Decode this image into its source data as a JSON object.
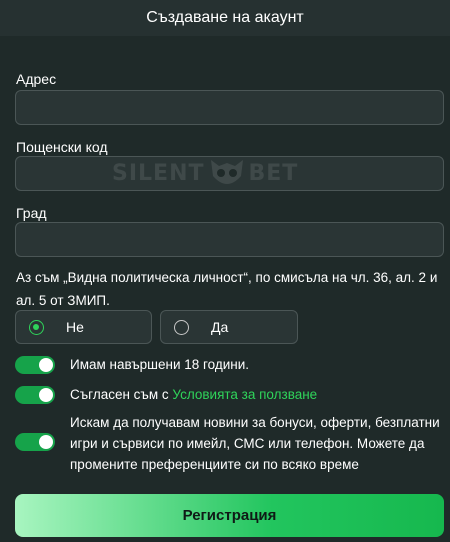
{
  "header": {
    "title": "Създаване на акаунт"
  },
  "form": {
    "address": {
      "label": "Адрес",
      "value": "",
      "placeholder": ""
    },
    "postal_code": {
      "label": "Пощенски код",
      "value": "",
      "placeholder": ""
    },
    "city": {
      "label": "Град",
      "value": "",
      "placeholder": ""
    },
    "pep_question": "Аз съм „Видна политическа личност“, по смисъла на чл. 36, ал. 2 и ал. 5 от ЗМИП.",
    "pep_options": [
      {
        "label": "Не",
        "selected": true
      },
      {
        "label": "Да",
        "selected": false
      }
    ],
    "toggles": [
      {
        "text": "Имам навършени 18 години.",
        "on": true
      },
      {
        "text_prefix": "Съгласен съм с ",
        "link": "Условията за ползване",
        "on": true
      },
      {
        "text": "Искам да получавам новини за бонуси, оферти, безплатни игри и сървиси по имейл, СМС или телефон. Можете да промените преференциите си по всяко време",
        "on": true
      }
    ],
    "submit_label": "Регистрация"
  },
  "watermark": {
    "left": "SILENT",
    "right": "BET"
  },
  "colors": {
    "accent": "#2fd45a",
    "background": "#1f2a29",
    "input_bg": "#2a3535",
    "border": "#4b5656"
  }
}
